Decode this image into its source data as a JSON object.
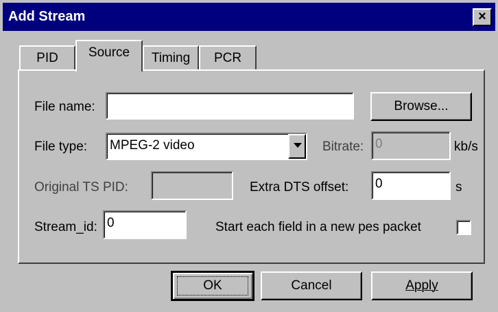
{
  "window": {
    "title": "Add Stream",
    "close_label": "×"
  },
  "tabs": [
    {
      "label": "PID",
      "selected": false
    },
    {
      "label": "Source",
      "selected": true
    },
    {
      "label": "Timing",
      "selected": false
    },
    {
      "label": "PCR",
      "selected": false
    }
  ],
  "source": {
    "file_name_label": "File name:",
    "file_name_value": "",
    "browse_label": "Browse...",
    "file_type_label": "File type:",
    "file_type_value": "MPEG-2 video",
    "bitrate_label": "Bitrate:",
    "bitrate_value": "0",
    "bitrate_unit": "kb/s",
    "orig_pid_label": "Original TS PID:",
    "orig_pid_value": "",
    "dts_label": "Extra DTS offset:",
    "dts_value": "0",
    "dts_unit": "s",
    "stream_id_label": "Stream_id:",
    "stream_id_value": "0",
    "pes_label": "Start each field in a new pes packet",
    "pes_checked": false
  },
  "buttons": {
    "ok": "OK",
    "cancel": "Cancel",
    "apply": "Apply"
  },
  "colors": {
    "titlebar": "#00007f",
    "face": "#c0c0c0"
  }
}
